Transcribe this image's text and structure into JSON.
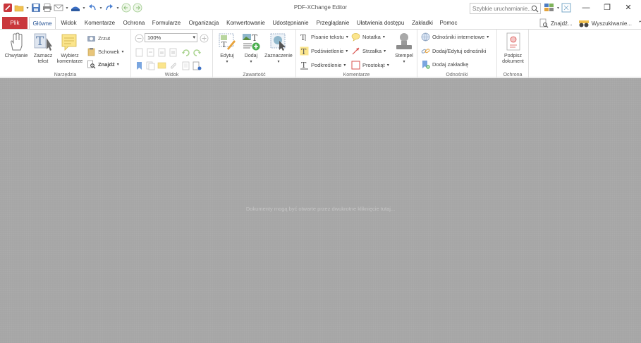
{
  "window": {
    "title": "PDF-XChange Editor",
    "search_placeholder": "Szybkie uruchamianie..."
  },
  "right_tools": {
    "find_label": "Znajdź...",
    "search_label": "Wyszukiwanie..."
  },
  "tabs": {
    "file": "Plik",
    "items": [
      "Główne",
      "Widok",
      "Komentarze",
      "Ochrona",
      "Formularze",
      "Organizacja",
      "Konwertowanie",
      "Udostępnianie",
      "Przeglądanie",
      "Ułatwienia dostępu",
      "Zakładki",
      "Pomoc"
    ]
  },
  "ribbon": {
    "narzedzia": {
      "label": "Narzędzia",
      "hand": "Chwytanie",
      "select_text_1": "Zaznacz",
      "select_text_2": "tekst",
      "select_comments_1": "Wybierz",
      "select_comments_2": "komentarze",
      "snapshot": "Zrzut",
      "clipboard": "Schowek",
      "find": "Znajdź"
    },
    "widok": {
      "label": "Widok",
      "zoom": "100%"
    },
    "zawartosc": {
      "label": "Zawartość",
      "edit": "Edytuj",
      "add": "Dodaj",
      "select": "Zaznaczenie"
    },
    "komentarze": {
      "label": "Komentarze",
      "typewriter": "Pisanie tekstu",
      "note": "Notatka",
      "highlight": "Podświetlenie",
      "arrow": "Strzałka",
      "underline": "Podkreślenie",
      "rectangle": "Prostokąt",
      "stamp": "Stempel"
    },
    "odnosniki": {
      "label": "Odnośniki",
      "links": "Odnośniki internetowe",
      "add_edit": "Dodaj/Edytuj odnośniki",
      "add_bookmark": "Dodaj zakładkę"
    },
    "ochrona": {
      "label": "Ochrona",
      "sign_1": "Podpisz",
      "sign_2": "dokument"
    }
  },
  "document_area": {
    "message": "Dokumenty mogą być otwarte przez dwukrotne kliknięcie tutaj..."
  },
  "colors": {
    "file_tab": "#c9373c",
    "active_tab_text": "#2b5797",
    "document_bg": "#a6a6a6"
  }
}
